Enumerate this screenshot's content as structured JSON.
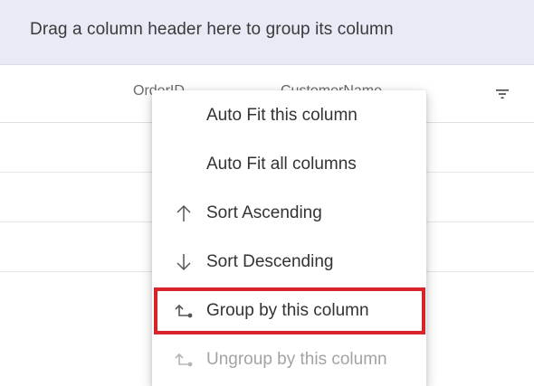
{
  "group_panel": {
    "text": "Drag a column header here to group its column"
  },
  "grid": {
    "columns": [
      {
        "label": "OrderID"
      },
      {
        "label": "CustomerName"
      }
    ]
  },
  "context_menu": {
    "items": [
      {
        "label": "Auto Fit this column",
        "icon": "",
        "enabled": true
      },
      {
        "label": "Auto Fit all columns",
        "icon": "",
        "enabled": true
      },
      {
        "label": "Sort Ascending",
        "icon": "arrow-up-icon",
        "enabled": true
      },
      {
        "label": "Sort Descending",
        "icon": "arrow-down-icon",
        "enabled": true
      },
      {
        "label": "Group by this column",
        "icon": "group-icon",
        "enabled": true,
        "highlighted": true
      },
      {
        "label": "Ungroup by this column",
        "icon": "ungroup-icon",
        "enabled": false
      }
    ]
  },
  "colors": {
    "highlight": "#d8232a",
    "group_panel_bg": "#e8eaf6"
  }
}
